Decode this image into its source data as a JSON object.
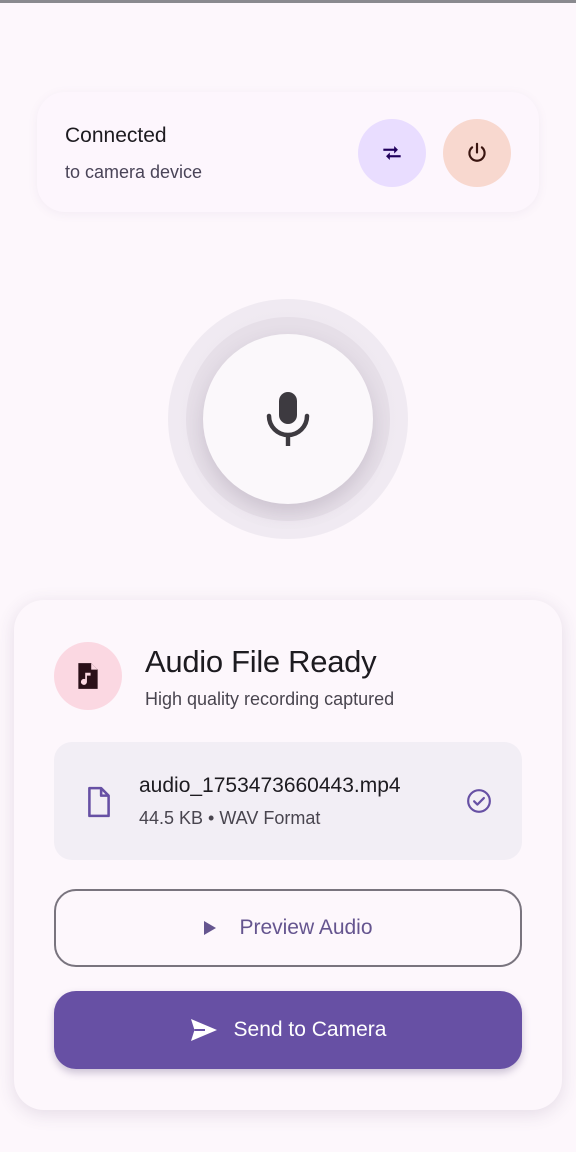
{
  "connection": {
    "title": "Connected",
    "subtitle": "to camera device",
    "swap_icon": "swap-arrows-icon",
    "power_icon": "power-icon"
  },
  "recorder": {
    "mic_icon": "microphone-icon"
  },
  "file_card": {
    "title": "Audio File Ready",
    "subtitle": "High quality recording captured",
    "badge_icon": "audio-file-icon",
    "file": {
      "name": "audio_1753473660443.mp4",
      "meta": "44.5 KB • WAV Format",
      "status_icon": "check-circle-icon"
    },
    "preview_label": "Preview Audio",
    "send_label": "Send to Camera"
  },
  "colors": {
    "background": "#fdf7fc",
    "primary": "#6750a4",
    "swap_bg": "#e9ddff",
    "power_bg": "#f8d8cf",
    "badge_bg": "#fbd8e2"
  }
}
